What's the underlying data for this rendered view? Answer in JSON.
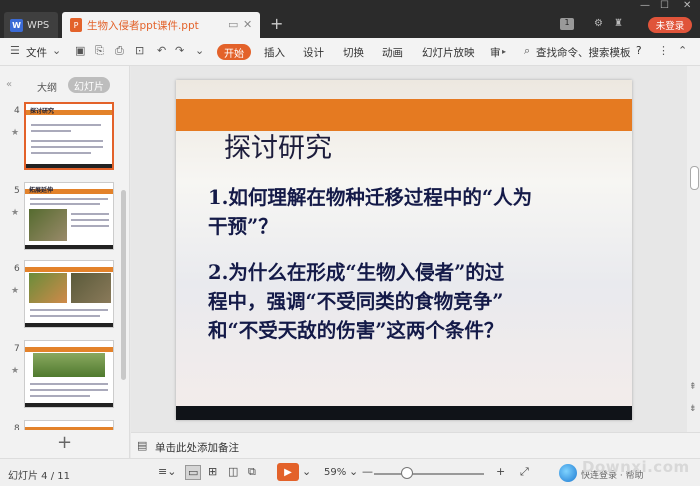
{
  "titlebar": {
    "app_name": "WPS",
    "document_title": "生物入侵者ppt课件.ppt",
    "login_label": "未登录",
    "badge": "1"
  },
  "ribbon": {
    "file_label": "文件",
    "tabs": [
      "开始",
      "插入",
      "设计",
      "切换",
      "动画",
      "幻灯片放映",
      "审"
    ],
    "search_label": "查找命令、搜索模板",
    "help": "?"
  },
  "leftpanel": {
    "tab_outline": "大纲",
    "tab_slides": "幻灯片",
    "thumbnails": [
      {
        "num": "4",
        "title": "探讨研究"
      },
      {
        "num": "5",
        "title": "拓展延伸"
      },
      {
        "num": "6",
        "title": ""
      },
      {
        "num": "7",
        "title": ""
      },
      {
        "num": "8",
        "title": ""
      }
    ]
  },
  "slide": {
    "title": "探讨研究",
    "q1_line1": "1.如何理解在物种迁移过程中的“人为",
    "q1_line2": "干预”？",
    "q2_line1": "2.为什么在形成“生物入侵者”的过",
    "q2_line2": "程中，强调“不受同类的食物竞争”",
    "q2_line3": "和“不受天敌的伤害”这两个条件？"
  },
  "notes": {
    "placeholder": "单击此处添加备注"
  },
  "statusbar": {
    "slide_count": "幻灯片 4 / 11",
    "zoom": "59%",
    "zoom_level": 0.3,
    "watermark_label": "快连登录 · 帮助"
  },
  "watermark": "Downxi.com",
  "colors": {
    "accent": "#e3622a",
    "band": "#e57a21",
    "text_dark": "#141a48"
  }
}
